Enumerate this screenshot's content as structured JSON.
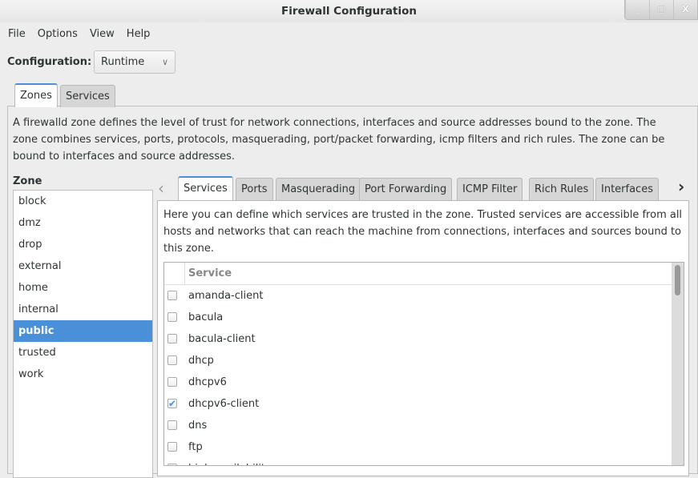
{
  "window": {
    "title": "Firewall Configuration",
    "controls": [
      "_",
      "□",
      "X"
    ]
  },
  "menu": [
    "File",
    "Options",
    "View",
    "Help"
  ],
  "configuration": {
    "label": "Configuration:",
    "value": "Runtime"
  },
  "main_tabs": [
    {
      "label": "Zones",
      "active": true
    },
    {
      "label": "Services",
      "active": false
    }
  ],
  "zones_description": "A firewalld zone defines the level of trust for network connections, interfaces and source addresses bound to the zone. The zone combines services, ports, protocols, masquerading, port/packet forwarding, icmp filters and rich rules. The zone can be bound to interfaces and source addresses.",
  "zone_label": "Zone",
  "zones": [
    "block",
    "dmz",
    "drop",
    "external",
    "home",
    "internal",
    "public",
    "trusted",
    "work"
  ],
  "selected_zone": "public",
  "zone_tabs": [
    {
      "label": "Services",
      "active": true
    },
    {
      "label": "Ports"
    },
    {
      "label": "Masquerading"
    },
    {
      "label": "Port Forwarding"
    },
    {
      "label": "ICMP Filter"
    },
    {
      "label": "Rich Rules"
    },
    {
      "label": "Interfaces"
    }
  ],
  "services_description": "Here you can define which services are trusted in the zone. Trusted services are accessible from all hosts and networks that can reach the machine from connections, interfaces and sources bound to this zone.",
  "service_column": "Service",
  "services": [
    {
      "name": "amanda-client",
      "checked": false
    },
    {
      "name": "bacula",
      "checked": false
    },
    {
      "name": "bacula-client",
      "checked": false
    },
    {
      "name": "dhcp",
      "checked": false
    },
    {
      "name": "dhcpv6",
      "checked": false
    },
    {
      "name": "dhcpv6-client",
      "checked": true
    },
    {
      "name": "dns",
      "checked": false
    },
    {
      "name": "ftp",
      "checked": false
    },
    {
      "name": "high-availability",
      "checked": false
    }
  ],
  "accent": "#4a90d9"
}
